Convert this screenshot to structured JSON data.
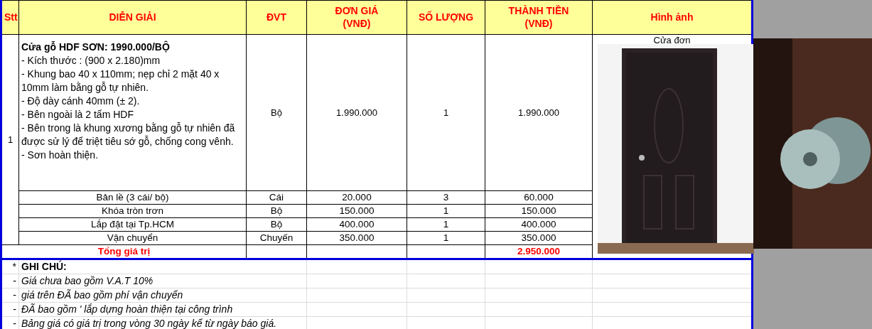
{
  "table": {
    "columns": [
      "Stt",
      "DIỄN GIẢI",
      "ĐVT",
      "ĐƠN GIÁ\n(VNĐ)",
      "SỐ LƯỢNG",
      "THÀNH TIỀN\n(VNĐ)",
      "Hình ảnh"
    ],
    "main_row": {
      "stt": "1",
      "title": "Cửa gỗ HDF SƠN: 1990.000/BỘ",
      "lines": [
        "- Kích thước : (900 x 2.180)mm",
        "- Khung bao 40 x 110mm; nẹp chỉ 2 mặt 40 x 10mm làm bằng gỗ tự nhiên.",
        "- Độ dày cánh 40mm (± 2).",
        "- Bên ngoài là 2 tấm HDF",
        "- Bên trong là khung xương bằng gỗ tự nhiên đã được sử lý để triệt tiêu sớ gỗ, chống cong vênh.",
        "- Sơn hoàn thiện."
      ],
      "unit": "Bộ",
      "unit_price": "1.990.000",
      "quantity": "1",
      "amount": "1.990.000",
      "image_caption": "Cửa đơn"
    },
    "rows": [
      {
        "description": "Bản lề (3 cái/ bộ)",
        "unit": "Cái",
        "unit_price": "20.000",
        "quantity": "3",
        "amount": "60.000"
      },
      {
        "description": "Khóa tròn trơn",
        "unit": "Bộ",
        "unit_price": "150.000",
        "quantity": "1",
        "amount": "150.000"
      },
      {
        "description": "Lắp đặt tại Tp.HCM",
        "unit": "Bộ",
        "unit_price": "400.000",
        "quantity": "1",
        "amount": "400.000"
      },
      {
        "description": "Vận chuyển",
        "unit": "Chuyến",
        "unit_price": "350.000",
        "quantity": "1",
        "amount": "350.000"
      }
    ],
    "total": {
      "label": "Tổng giá trị",
      "amount": "2.950.000"
    }
  },
  "notes": [
    {
      "kind": "heading",
      "marker": "*",
      "text": "GHI CHÚ:"
    },
    {
      "kind": "item",
      "marker": "-",
      "text": "Giá chưa bao gồm V.A.T 10%"
    },
    {
      "kind": "item",
      "marker": "-",
      "text": "giá trên ĐÃ bao gồm phí vận chuyển"
    },
    {
      "kind": "item",
      "marker": "-",
      "text": "ĐÃ bao gồm ' lắp dựng hoàn thiện tại công trình"
    },
    {
      "kind": "item",
      "marker": "-",
      "text": "Bảng giá có giá trị trong vòng 30 ngày kể từ ngày báo giá."
    }
  ]
}
